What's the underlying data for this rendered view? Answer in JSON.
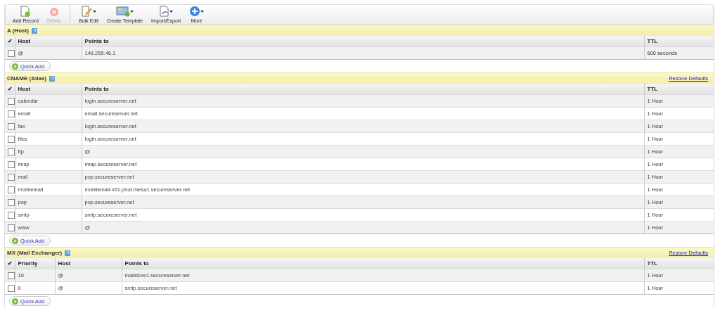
{
  "toolbar": [
    {
      "kind": "add",
      "label": "Add Record",
      "disabled": false,
      "dropdown": false
    },
    {
      "kind": "delete",
      "label": "Delete",
      "disabled": true,
      "dropdown": false
    },
    {
      "kind": "separator"
    },
    {
      "kind": "edit",
      "label": "Bulk Edit",
      "disabled": false,
      "dropdown": true
    },
    {
      "kind": "template",
      "label": "Create Template",
      "disabled": false,
      "dropdown": true
    },
    {
      "kind": "import",
      "label": "Import/Export",
      "disabled": false,
      "dropdown": true
    },
    {
      "kind": "more",
      "label": "More",
      "disabled": false,
      "dropdown": true
    }
  ],
  "sections": [
    {
      "title": "A (Host)",
      "check_header": "✔",
      "columns": [
        {
          "kind": "host",
          "label": "Host"
        },
        {
          "kind": "points",
          "label": "Points to"
        },
        {
          "kind": "ttl",
          "label": "TTL"
        }
      ],
      "rows": [
        {
          "checked": false,
          "cells": [
            "@",
            "146.255.46.1",
            "600 seconds"
          ]
        }
      ],
      "quick_add": "Quick Add"
    },
    {
      "title": "CNAME (Alias)",
      "restore": "Restore Defaults",
      "check_header": "✔",
      "columns": [
        {
          "kind": "host",
          "label": "Host"
        },
        {
          "kind": "points",
          "label": "Points to"
        },
        {
          "kind": "ttl",
          "label": "TTL"
        }
      ],
      "rows": [
        {
          "checked": false,
          "cells": [
            "calendar",
            "login.secureserver.net",
            "1 Hour"
          ]
        },
        {
          "checked": false,
          "cells": [
            "email",
            "email.secureserver.net",
            "1 Hour"
          ]
        },
        {
          "checked": false,
          "cells": [
            "fax",
            "login.secureserver.net",
            "1 Hour"
          ]
        },
        {
          "checked": false,
          "cells": [
            "files",
            "login.secureserver.net",
            "1 Hour"
          ]
        },
        {
          "checked": false,
          "cells": [
            "ftp",
            "@",
            "1 Hour"
          ]
        },
        {
          "checked": false,
          "cells": [
            "imap",
            "imap.secureserver.net",
            "1 Hour"
          ]
        },
        {
          "checked": false,
          "cells": [
            "mail",
            "pop.secureserver.net",
            "1 Hour"
          ]
        },
        {
          "checked": false,
          "cells": [
            "mobilemail",
            "mobilemail-v01.prod.mesa1.secureserver.net",
            "1 Hour"
          ]
        },
        {
          "checked": false,
          "cells": [
            "pop",
            "pop.secureserver.net",
            "1 Hour"
          ]
        },
        {
          "checked": false,
          "cells": [
            "smtp",
            "smtp.secureserver.net",
            "1 Hour"
          ]
        },
        {
          "checked": false,
          "cells": [
            "www",
            "@",
            "1 Hour"
          ]
        }
      ],
      "quick_add": "Quick Add"
    },
    {
      "title": "MX (Mail Exchanger)",
      "restore": "Restore Defaults",
      "check_header": "✔",
      "columns": [
        {
          "kind": "priority",
          "label": "Priority"
        },
        {
          "kind": "host",
          "label": "Host"
        },
        {
          "kind": "points",
          "label": "Points to"
        },
        {
          "kind": "ttl",
          "label": "TTL"
        }
      ],
      "rows": [
        {
          "checked": false,
          "cells": [
            "10",
            "@",
            "mailstore1.secureserver.net",
            "1 Hour"
          ]
        },
        {
          "checked": false,
          "cells": [
            "0",
            "@",
            "smtp.secureserver.net",
            "1 Hour"
          ]
        }
      ],
      "quick_add": "Quick Add"
    }
  ]
}
